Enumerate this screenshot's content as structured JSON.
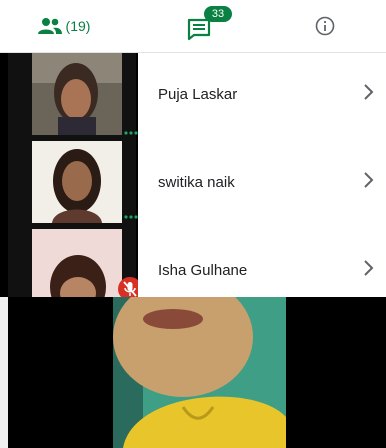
{
  "tabs": {
    "people_count": "(19)",
    "chat_badge": "33"
  },
  "participants": [
    {
      "name": "Puja Laskar",
      "muted": false
    },
    {
      "name": "switika naik",
      "muted": false
    },
    {
      "name": "Isha Gulhane",
      "muted": true
    }
  ],
  "colors": {
    "accent_green": "#0b8043",
    "mute_red": "#d93025"
  }
}
